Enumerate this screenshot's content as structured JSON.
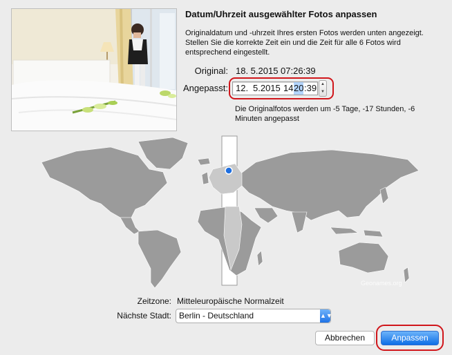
{
  "dialog": {
    "title": "Datum/Uhrzeit ausgewählter Fotos anpassen",
    "description": "Originaldatum und -uhrzeit Ihres ersten Fotos werden unten angezeigt. Stellen Sie die korrekte Zeit ein und die Zeit für alle 6 Fotos wird entsprechend eingestellt.",
    "original_label": "Original:",
    "original_value": "18.  5.2015 07:26:39",
    "adjusted_label": "Angepasst:",
    "adjusted": {
      "day": "12.",
      "month_year": "5.2015",
      "hour": "14:",
      "minute": "20",
      "second": ":39"
    },
    "note": "Die Originalfotos werden um -5 Tage, -17 Stunden, -6 Minuten angepasst"
  },
  "map": {
    "credit": "Geonames.org",
    "land_color": "#9b9b9b",
    "highlight_color": "#c9c9c9",
    "marker_color": "#1f6fe0"
  },
  "timezone": {
    "label": "Zeitzone:",
    "value": "Mitteleuropäische Normalzeit"
  },
  "city": {
    "label": "Nächste Stadt:",
    "value": "Berlin - Deutschland"
  },
  "buttons": {
    "cancel": "Abbrechen",
    "ok": "Anpassen"
  },
  "colors": {
    "annotation_ring": "#d0151a",
    "primary_button": "#0e6fe7"
  }
}
